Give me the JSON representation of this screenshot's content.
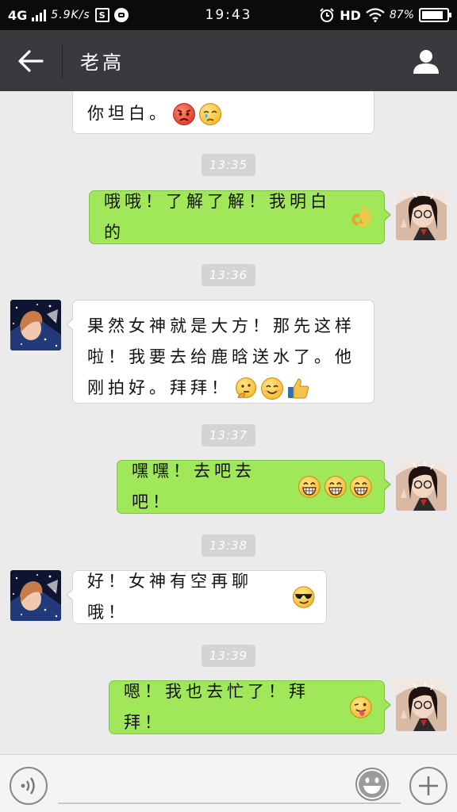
{
  "status_bar": {
    "network": "4G",
    "speed": "5.9K/s",
    "sim_badge": "S",
    "time": "19:43",
    "hd": "HD",
    "battery": "87%",
    "battery_level": 0.87,
    "icons": [
      "signal-icon",
      "sim-icon",
      "chat-notification-icon",
      "alarm-icon",
      "wifi-icon",
      "battery-icon"
    ]
  },
  "header": {
    "title": "老高",
    "back_icon": "back-arrow-icon",
    "profile_icon": "person-icon"
  },
  "messages": [
    {
      "side": "in",
      "text": "你坦白。",
      "emojis": [
        "angry-face",
        "crying-face"
      ]
    },
    {
      "time": "13:35"
    },
    {
      "side": "out",
      "text": "哦哦！了解了解！我明白的",
      "emojis": [
        "ok-hand"
      ]
    },
    {
      "time": "13:36"
    },
    {
      "side": "in",
      "lines": [
        "果然女神就是大方！那先这样",
        "啦！我要去给鹿晗送水了。他",
        "刚拍好。拜拜！"
      ],
      "emojis": [
        "thinking-face",
        "smiling-face",
        "thumbs-up"
      ]
    },
    {
      "time": "13:37"
    },
    {
      "side": "out",
      "text": "嘿嘿！去吧去吧！",
      "emojis": [
        "grinning-face",
        "grinning-face",
        "grinning-face"
      ]
    },
    {
      "time": "13:38"
    },
    {
      "side": "in",
      "text": "好！女神有空再聊哦！",
      "emojis": [
        "sunglasses-face"
      ]
    },
    {
      "time": "13:39"
    },
    {
      "side": "out",
      "text": "嗯！我也去忙了！拜拜！",
      "emojis": [
        "winking-tongue-face"
      ]
    }
  ],
  "input_bar": {
    "voice_icon": "voice-icon",
    "emoji_icon": "smiley-icon",
    "plus_icon": "plus-icon",
    "input_value": ""
  },
  "colors": {
    "status_bar": "#0b0b0b",
    "header": "#393a3e",
    "background": "#ebebeb",
    "outgoing_bubble": "#a0e75a",
    "incoming_bubble": "#ffffff",
    "timestamp_pill": "#d4d4d4"
  }
}
